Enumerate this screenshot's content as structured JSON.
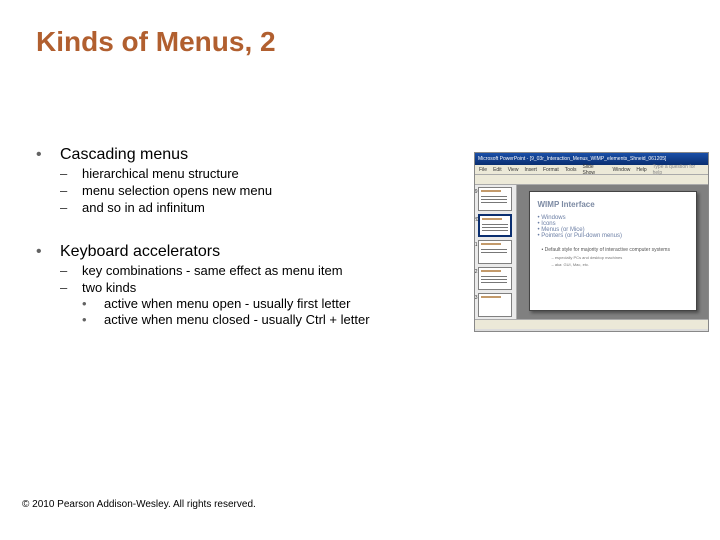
{
  "title": "Kinds of Menus, 2",
  "section1": {
    "heading": "Cascading menus",
    "items": [
      "hierarchical menu structure",
      "menu selection opens new menu",
      "and so in ad infinitum"
    ]
  },
  "section2": {
    "heading": "Keyboard accelerators",
    "items": [
      "key combinations - same effect as menu item",
      "two kinds"
    ],
    "subitems": [
      "active when menu open - usually first letter",
      "active when menu closed - usually Ctrl + letter"
    ]
  },
  "screenshot": {
    "app_title": "Microsoft PowerPoint - [9_03r_Interaction_Menus_WIMP_elements_Shneid_061205]",
    "menus": [
      "File",
      "Edit",
      "View",
      "Insert",
      "Format",
      "Tools",
      "Slide Show",
      "Window",
      "Help"
    ],
    "help_hint": "Type a question for help",
    "slide": {
      "title": "WIMP Interface",
      "bullets": [
        "Windows",
        "Icons",
        "Menus (or Mice)",
        "Pointers (or Pull-down menus)"
      ],
      "note1": "• Default style for majority of interactive computer systems",
      "note2": "– especially PCs and desktop machines",
      "note3": "– aka: GUI, Mac, etc."
    }
  },
  "copyright": "© 2010 Pearson Addison-Wesley. All rights reserved."
}
